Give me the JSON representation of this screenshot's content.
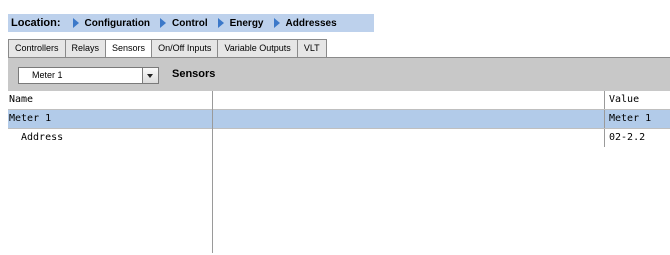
{
  "breadcrumb": {
    "lead": "Location:",
    "items": [
      {
        "label": "Configuration"
      },
      {
        "label": "Control"
      },
      {
        "label": "Energy"
      },
      {
        "label": "Addresses"
      }
    ]
  },
  "tabs": [
    {
      "label": "Controllers",
      "active": false
    },
    {
      "label": "Relays",
      "active": false
    },
    {
      "label": "Sensors",
      "active": true
    },
    {
      "label": "On/Off Inputs",
      "active": false
    },
    {
      "label": "Variable Outputs",
      "active": false
    },
    {
      "label": "VLT",
      "active": false
    }
  ],
  "toolbar": {
    "selected_meter": "Meter 1",
    "title": "Sensors"
  },
  "table": {
    "headers": {
      "name": "Name",
      "value": "Value"
    },
    "rows": [
      {
        "name": "Meter 1",
        "value": "Meter 1"
      },
      {
        "name": "Address",
        "value": "02-2.2"
      }
    ]
  },
  "colors": {
    "breadcrumb_bg": "#bdd1ec",
    "selected_row": "#b2cbe9",
    "toolbar_bg": "#c8c8c8",
    "arrow": "#3b78c9"
  }
}
